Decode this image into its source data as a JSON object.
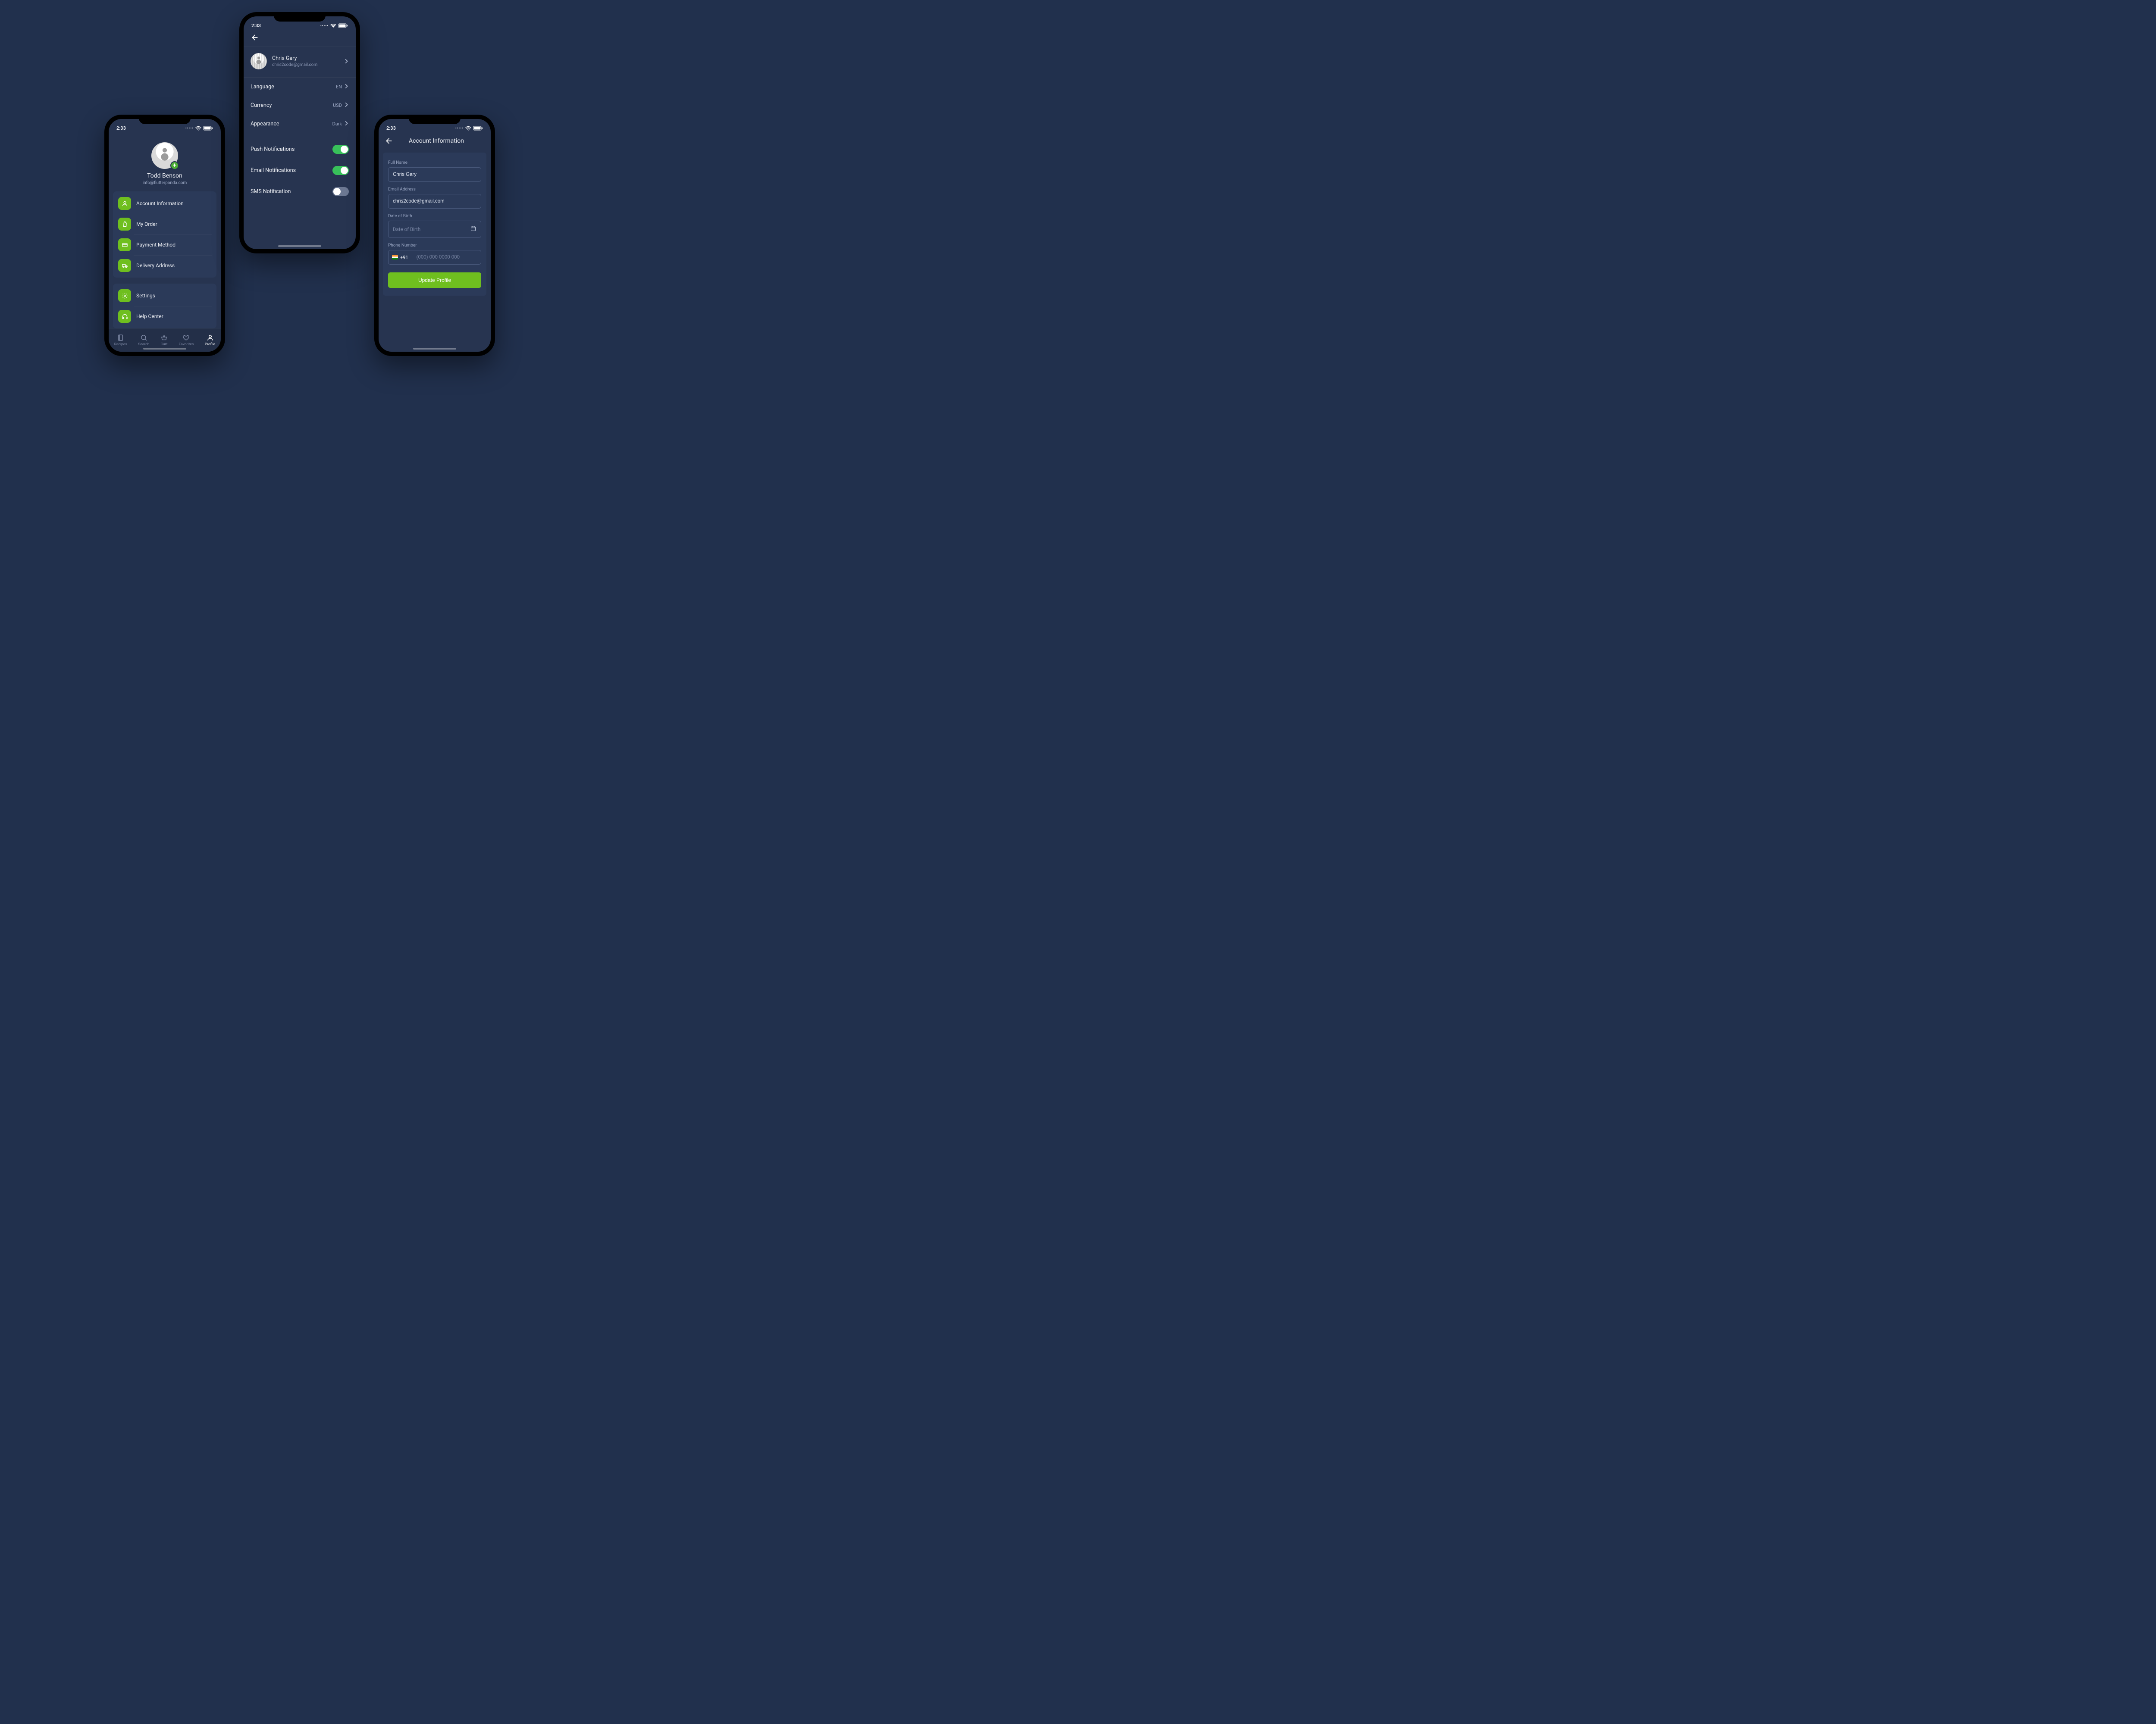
{
  "status": {
    "time": "2:33"
  },
  "profile": {
    "name": "Todd Benson",
    "email": "info@flutterpanda.com",
    "menu1": [
      {
        "label": "Account Information"
      },
      {
        "label": "My Order"
      },
      {
        "label": "Payment Method"
      },
      {
        "label": "Delivery Address"
      }
    ],
    "menu2": [
      {
        "label": "Settings"
      },
      {
        "label": "Help Center"
      }
    ],
    "tabs": [
      {
        "label": "Recipes"
      },
      {
        "label": "Search"
      },
      {
        "label": "Cart"
      },
      {
        "label": "Favorites"
      },
      {
        "label": "Profile"
      }
    ]
  },
  "settings": {
    "user": {
      "name": "Chris Gary",
      "email": "chris2code@gmail.com"
    },
    "rows": [
      {
        "label": "Language",
        "value": "EN"
      },
      {
        "label": "Currency",
        "value": "USD"
      },
      {
        "label": "Appearance",
        "value": "Dark"
      }
    ],
    "toggles": [
      {
        "label": "Push Notifications",
        "on": true
      },
      {
        "label": "Email Notifications",
        "on": true
      },
      {
        "label": "SMS Notification",
        "on": false
      }
    ]
  },
  "account": {
    "title": "Account Information",
    "fields": {
      "full_name": {
        "label": "Full Name",
        "value": "Chris Gary"
      },
      "email": {
        "label": "Email Address",
        "value": "chris2code@gmail.com"
      },
      "dob": {
        "label": "Date of Birth",
        "placeholder": "Date of Birth"
      },
      "phone": {
        "label": "Phone Number",
        "cc": "+91",
        "placeholder": "(000) 000 0000 000"
      }
    },
    "button": "Update Profile"
  }
}
